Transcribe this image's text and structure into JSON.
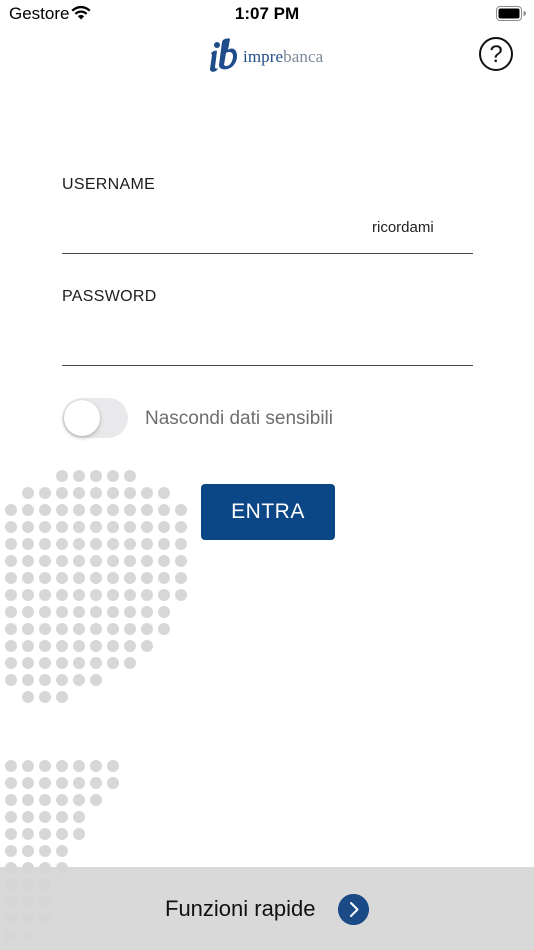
{
  "status_bar": {
    "carrier": "Gestore",
    "time": "1:07 PM"
  },
  "header": {
    "logo_part_a": "impre",
    "logo_part_b": "banca",
    "help_glyph": "?"
  },
  "login_form": {
    "username_label": "USERNAME",
    "username_value": "",
    "remember_label": "ricordami",
    "password_label": "PASSWORD",
    "password_value": "",
    "hide_sensitive_label": "Nascondi dati sensibili",
    "hide_sensitive_enabled": false,
    "submit_label": "ENTRA"
  },
  "bottom_bar": {
    "label": "Funzioni rapide"
  },
  "icons": {
    "wifi": "wifi-icon",
    "battery": "battery-icon",
    "help": "question-mark-icon",
    "arrow": "chevron-right-icon"
  },
  "colors": {
    "primary": "#0b4686",
    "logo_blue": "#1f4c8a",
    "logo_grey": "#7d8a99",
    "toggle_off": "#e9e9eb",
    "dots": "#d7d7d7",
    "bottom_bar": "#d6d6d6"
  }
}
